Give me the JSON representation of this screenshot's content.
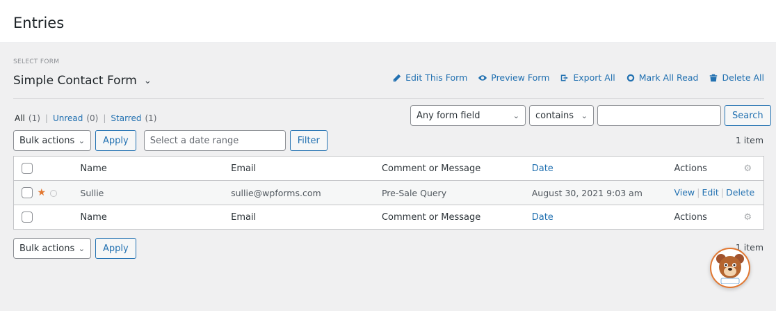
{
  "header": {
    "title": "Entries"
  },
  "form_selector": {
    "label": "SELECT FORM",
    "selected": "Simple Contact Form"
  },
  "top_actions": {
    "edit": "Edit This Form",
    "preview": "Preview Form",
    "export": "Export All",
    "mark_read": "Mark All Read",
    "delete": "Delete All"
  },
  "views": {
    "all": {
      "label": "All",
      "count": "(1)"
    },
    "unread": {
      "label": "Unread",
      "count": "(0)"
    },
    "starred": {
      "label": "Starred",
      "count": "(1)"
    },
    "separator": "|"
  },
  "search": {
    "field_select": "Any form field",
    "operator_select": "contains",
    "button": "Search"
  },
  "controls": {
    "bulk_actions": "Bulk actions",
    "apply": "Apply",
    "date_placeholder": "Select a date range",
    "filter": "Filter",
    "items_count": "1 item"
  },
  "table": {
    "columns": {
      "name": "Name",
      "email": "Email",
      "comment": "Comment or Message",
      "date": "Date",
      "actions": "Actions"
    },
    "rows": [
      {
        "name": "Sullie",
        "email": "sullie@wpforms.com",
        "comment": "Pre-Sale Query",
        "date": "August 30, 2021 9:03 am",
        "starred": true,
        "actions": {
          "view": "View",
          "edit": "Edit",
          "delete": "Delete",
          "separator": "|"
        }
      }
    ]
  },
  "colors": {
    "link": "#2271b1",
    "star": "#e27730",
    "mascot_border": "#e27730"
  },
  "icons": {
    "edit": "pencil-icon",
    "preview": "eye-icon",
    "export": "export-icon",
    "mark_read": "circle-icon",
    "delete": "trash-icon",
    "gear": "gear-icon",
    "star": "star-icon",
    "mascot": "wpforms-bear-icon"
  }
}
